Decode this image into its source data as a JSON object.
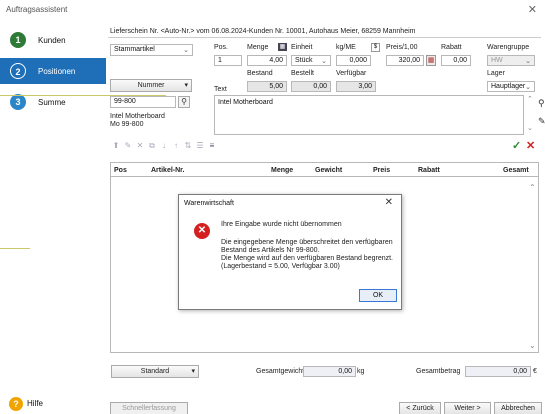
{
  "window": {
    "title": "Auftragsassistent",
    "close_glyph": "✕"
  },
  "sidebar": {
    "steps": [
      {
        "num": "1",
        "label": "Kunden"
      },
      {
        "num": "2",
        "label": "Positionen"
      },
      {
        "num": "3",
        "label": "Summe"
      }
    ],
    "help_label": "Hilfe",
    "help_glyph": "?"
  },
  "header": {
    "info_line": "Lieferschein Nr. <Auto-Nr.> vom 06.08.2024-Kunden Nr. 10001, Autohaus Meier, 68259 Mannheim"
  },
  "position": {
    "artikel_type": "Stammartikel",
    "pos_label": "Pos.",
    "pos_value": "1",
    "menge_label": "Menge",
    "menge_value": "4,00",
    "einheit_label": "Einheit",
    "einheit_value": "Stück",
    "kg_label": "kg/ME",
    "kg_value": "0,000",
    "currency": "$",
    "preis_label": "Preis/1,00",
    "preis_value": "320,00",
    "rabatt_label": "Rabatt",
    "rabatt_value": "0,00",
    "warengruppe_label": "Warengruppe",
    "warengruppe_value": "HW",
    "bestand_label": "Bestand",
    "bestand_value": "5,00",
    "bestellt_label": "Bestellt",
    "bestellt_value": "0,00",
    "verfuegbar_label": "Verfügbar",
    "verfuegbar_value": "3,00",
    "lager_label": "Lager",
    "lager_value": "Hauptlager",
    "nummer_label": "Nummer",
    "text_label": "Text",
    "artikel_nr_value": "99-800",
    "artikel_name": "Intel Motherboard",
    "artikel_sub": "Mo 99-800",
    "text_value": "Intel Motherboard"
  },
  "table": {
    "columns": [
      "Pos",
      "Artikel-Nr.",
      "Menge",
      "Gewicht",
      "Preis",
      "Rabatt",
      "Gesamt"
    ]
  },
  "dialog": {
    "title": "Warenwirtschaft",
    "line1": "Ihre Eingabe wurde nicht übernommen",
    "line2": "Die eingegebene Menge überschreitet den verfügbaren",
    "line3": "Bestand des Artikels Nr 99-800.",
    "line4": "Die Menge wird auf den verfügbaren Bestand begrenzt.",
    "line5": "(Lagerbestand = 5.00, Verfügbar 3.00)",
    "ok_label": "OK"
  },
  "footer": {
    "standard_label": "Standard",
    "gesamtgewicht_label": "Gesamtgewicht",
    "gesamtgewicht_value": "0,00",
    "gesamtgewicht_unit": "kg",
    "gesamtbetrag_label": "Gesamtbetrag",
    "gesamtbetrag_value": "0,00",
    "gesamtbetrag_unit": "€",
    "schnellerfassung_label": "Schnellerfassung",
    "back_label": "< Zurück",
    "next_label": "Weiter >",
    "cancel_label": "Abbrechen"
  },
  "colors": {
    "accent": "#1e6fb8",
    "step_done": "#2f7a37",
    "error": "#d42020",
    "callout_line": "#c9c96a"
  }
}
